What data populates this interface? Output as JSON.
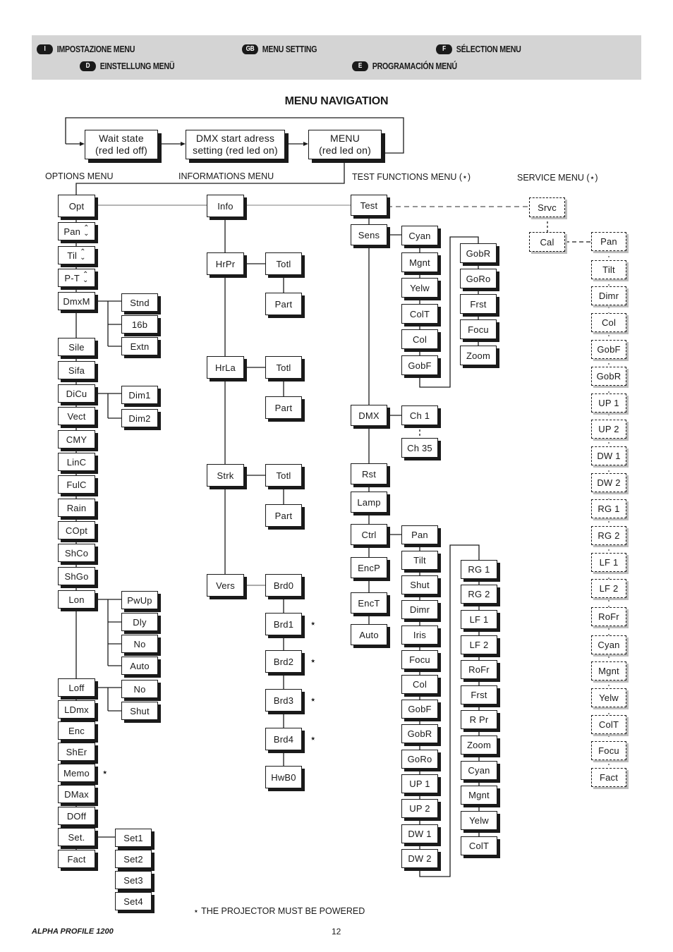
{
  "header": {
    "languages": [
      {
        "code": "I",
        "label": "IMPOSTAZIONE MENU"
      },
      {
        "code": "GB",
        "label": "MENU SETTING"
      },
      {
        "code": "F",
        "label": "SÉLECTION MENU"
      },
      {
        "code": "D",
        "label": "EINSTELLUNG MENÜ"
      },
      {
        "code": "E",
        "label": "PROGRAMACIÓN MENÚ"
      }
    ],
    "banner_color": "#d4d4d4"
  },
  "title": "MENU NAVIGATION",
  "flow": [
    {
      "line1": "Wait state",
      "line2": "(red led off)"
    },
    {
      "line1": "DMX start adress",
      "line2": "setting (red led on)"
    },
    {
      "line1": "MENU",
      "line2": "(red led on)"
    }
  ],
  "sections": {
    "options": "OPTIONS MENU",
    "informations": "INFORMATIONS MENU",
    "test": "TEST FUNCTIONS MENU (⋆)",
    "service": "SERVICE MENU (⋆)"
  },
  "options_menu": {
    "root": "Opt",
    "items": [
      "Pan",
      "Til",
      "P-T",
      "DmxM",
      "Sile",
      "Sifa",
      "DiCu",
      "Vect",
      "CMY",
      "LinC",
      "FulC",
      "Rain",
      "COpt",
      "ShCo",
      "ShGo",
      "Lon",
      "Loff",
      "LDmx",
      "Enc",
      "ShEr",
      "Memo",
      "DMax",
      "DOff",
      "Set.",
      "Fact"
    ],
    "updown_items": [
      "Pan",
      "Til",
      "P-T"
    ],
    "starred": [
      "Memo"
    ],
    "dmxm_sub": [
      "Stnd",
      "16b",
      "Extn"
    ],
    "dicu_sub": [
      "Dim1",
      "Dim2"
    ],
    "lon_sub": [
      "PwUp",
      "Dly",
      "No",
      "Auto"
    ],
    "loff_sub": [
      "No",
      "Shut"
    ],
    "set_sub": [
      "Set1",
      "Set2",
      "Set3",
      "Set4"
    ]
  },
  "info_menu": {
    "root": "Info",
    "items": [
      "HrPr",
      "HrLa",
      "Strk",
      "Vers"
    ],
    "hrpr_sub": [
      "Totl",
      "Part"
    ],
    "hrla_sub": [
      "Totl",
      "Part"
    ],
    "strk_sub": [
      "Totl",
      "Part"
    ],
    "vers_sub": [
      "Brd0",
      "Brd1",
      "Brd2",
      "Brd3",
      "Brd4",
      "HwB0"
    ],
    "vers_starred": [
      "Brd1",
      "Brd2",
      "Brd3",
      "Brd4"
    ]
  },
  "test_menu": {
    "root": "Test",
    "items": [
      "Sens",
      "DMX",
      "Rst",
      "Lamp",
      "Ctrl",
      "EncP",
      "EncT",
      "Auto"
    ],
    "sens_sub_a": [
      "Cyan",
      "Mgnt",
      "Yelw",
      "ColT",
      "Col",
      "GobF"
    ],
    "sens_sub_b": [
      "GobR",
      "GoRo",
      "Frst",
      "Focu",
      "Zoom"
    ],
    "dmx_sub": [
      "Ch 1",
      "Ch 35"
    ],
    "ctrl_sub_a": [
      "Pan",
      "Tilt",
      "Shut",
      "Dimr",
      "Iris",
      "Focu",
      "Col",
      "GobF",
      "GobR",
      "GoRo",
      "UP 1",
      "UP 2",
      "DW 1",
      "DW 2"
    ],
    "ctrl_sub_b": [
      "RG 1",
      "RG 2",
      "LF 1",
      "LF 2",
      "RoFr",
      "Frst",
      "R Pr",
      "Zoom",
      "Cyan",
      "Mgnt",
      "Yelw",
      "ColT"
    ]
  },
  "service_menu": {
    "root": "Srvc",
    "cal": "Cal",
    "items": [
      "Pan",
      "Tilt",
      "Dimr",
      "Col",
      "GobF",
      "GobR",
      "UP 1",
      "UP 2",
      "DW 1",
      "DW 2",
      "RG 1",
      "RG 2",
      "LF 1",
      "LF 2",
      "RoFr",
      "Cyan",
      "Mgnt",
      "Yelw",
      "ColT",
      "Focu",
      "Fact"
    ]
  },
  "footnote": "⋆ THE PROJECTOR MUST BE POWERED",
  "star_glyph": "⋆",
  "footer": {
    "product": "ALPHA PROFILE 1200",
    "page": "12"
  }
}
